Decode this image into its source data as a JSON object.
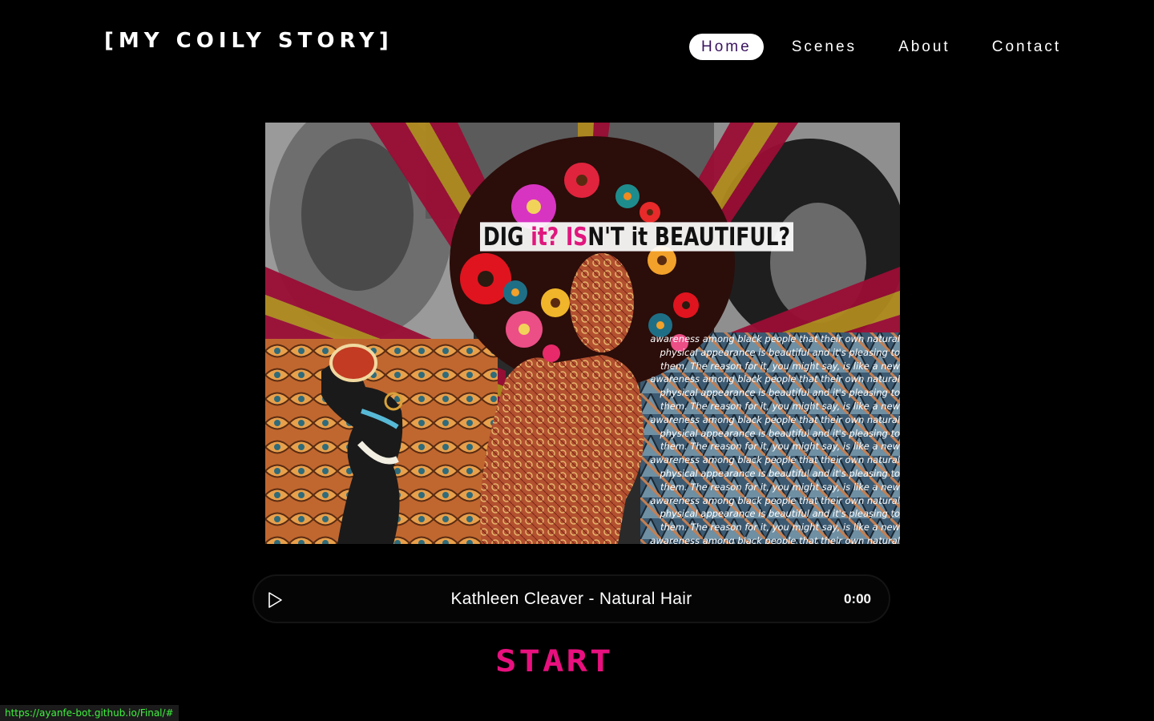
{
  "site": {
    "brand": "[MY COILY STORY]"
  },
  "nav": {
    "items": [
      {
        "label": "Home",
        "active": true
      },
      {
        "label": "Scenes",
        "active": false
      },
      {
        "label": "About",
        "active": false
      },
      {
        "label": "Contact",
        "active": false
      }
    ]
  },
  "hero": {
    "caption_part1": "DIG ",
    "caption_pink1": "it? IS",
    "caption_part2": "N'T it BEAUTIFUL?",
    "quote_text": "awareness among black people that their own natural physical appearance is beautiful and it's pleasing to them. The reason for it, you might say, is like a new awareness among black people that their own natural physical appearance is beautiful and it's pleasing to them. The reason for it, you might say, is like a new awareness among black people that their own natural physical appearance is beautiful and it's pleasing to them. The reason for it, you might say, is like a new awareness among black people that their own natural physical appearance is beautiful and it's pleasing to them. The reason for it, you might say, is like a new awareness among black people that their own natural physical appearance is beautiful and it's pleasing to them. The reason for it, you might say, is like a new awareness among black people that their own natural physical appearance is",
    "colors": {
      "ray_red": "#9b0d35",
      "ray_gold": "#b08a1e",
      "afro": "#2b0d0a",
      "skin_pattern": "#b2502f"
    }
  },
  "player": {
    "play_icon": "play-icon",
    "track_title": "Kathleen Cleaver - Natural Hair",
    "time": "0:00"
  },
  "start": {
    "label": "START",
    "color": "#e8107e"
  },
  "status_bar": {
    "url": "https://ayanfe-bot.github.io/Final/#"
  }
}
